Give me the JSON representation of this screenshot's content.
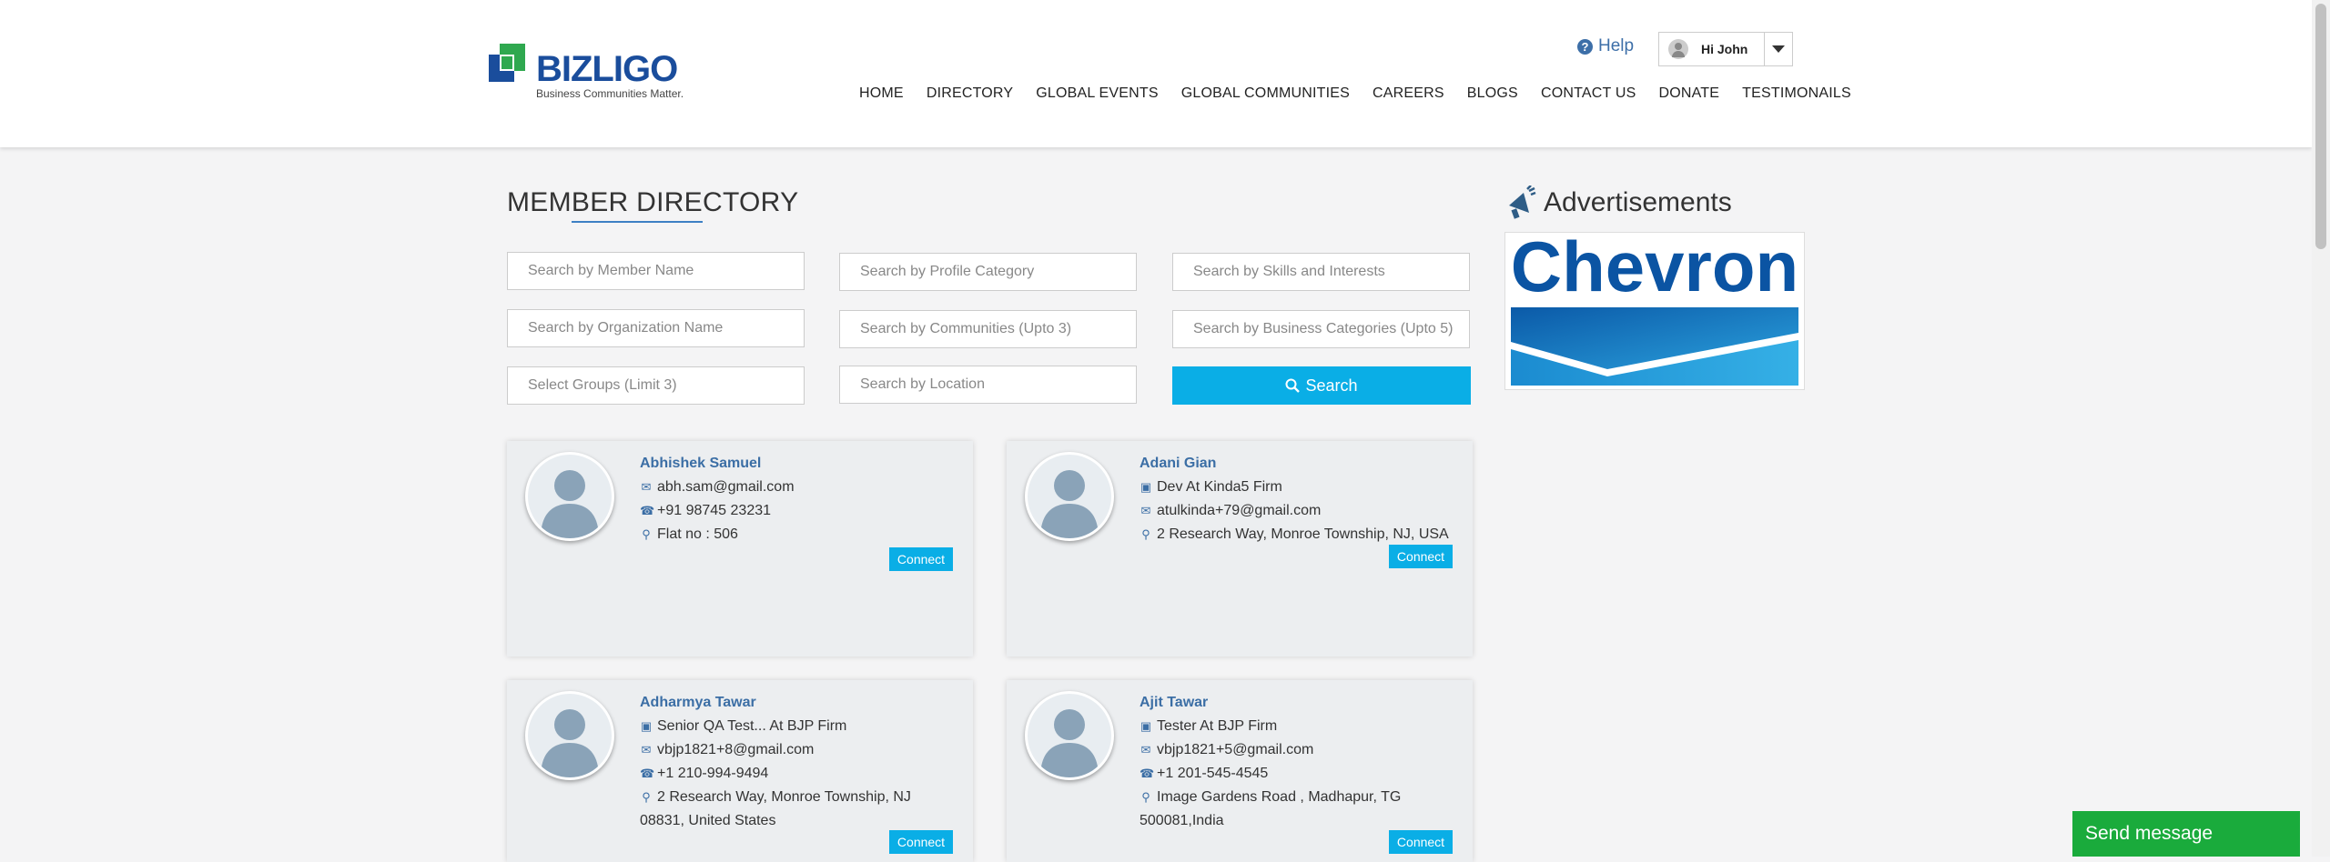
{
  "header": {
    "logo_text": "BIZLIGO",
    "logo_tagline": "Business Communities Matter.",
    "help_label": "Help",
    "user_greeting": "Hi John",
    "nav": [
      "HOME",
      "DIRECTORY",
      "GLOBAL EVENTS",
      "GLOBAL COMMUNITIES",
      "CAREERS",
      "BLOGS",
      "CONTACT US",
      "DONATE",
      "TESTIMONAILS"
    ]
  },
  "main": {
    "title": "MEMBER DIRECTORY",
    "search": {
      "member_name": "Search by Member Name",
      "profile_category": "Search by Profile Category",
      "skills": "Search by Skills and Interests",
      "organization": "Search by Organization Name",
      "communities": "Search by Communities (Upto 3)",
      "business_categories": "Search by Business Categories (Upto 5)",
      "groups": "Select Groups (Limit 3)",
      "location": "Search by Location",
      "button_label": "Search"
    },
    "members": [
      {
        "name": "Abhishek Samuel",
        "email": "abh.sam@gmail.com",
        "phone": "+91 98745 23231",
        "location": "Flat no : 506",
        "connect_label": "Connect"
      },
      {
        "name": "Adani Gian",
        "job": "Dev At Kinda5 Firm",
        "email": "atulkinda+79@gmail.com",
        "location": "2 Research Way, Monroe Township, NJ, USA",
        "connect_label": "Connect"
      },
      {
        "name": "Adharmya Tawar",
        "job": "Senior QA Test... At BJP Firm",
        "email": "vbjp1821+8@gmail.com",
        "phone": "+1 210-994-9494",
        "location_line1": "2 Research Way, Monroe Township, NJ",
        "location_line2": "08831, United States",
        "connect_label": "Connect"
      },
      {
        "name": "Ajit Tawar",
        "job": "Tester At BJP Firm",
        "email": "vbjp1821+5@gmail.com",
        "phone": "+1 201-545-4545",
        "location_line1": "Image Gardens Road , Madhapur, TG",
        "location_line2": "500081,India",
        "connect_label": "Connect"
      }
    ]
  },
  "ads": {
    "title": "Advertisements",
    "ad_brand": "Chevron",
    "brand_blue": "#0b54a3"
  },
  "chat": {
    "label": "Send message"
  },
  "colors": {
    "accent": "#0aaee6",
    "link": "#3b6ea5",
    "chat_green": "#1aab3c"
  }
}
